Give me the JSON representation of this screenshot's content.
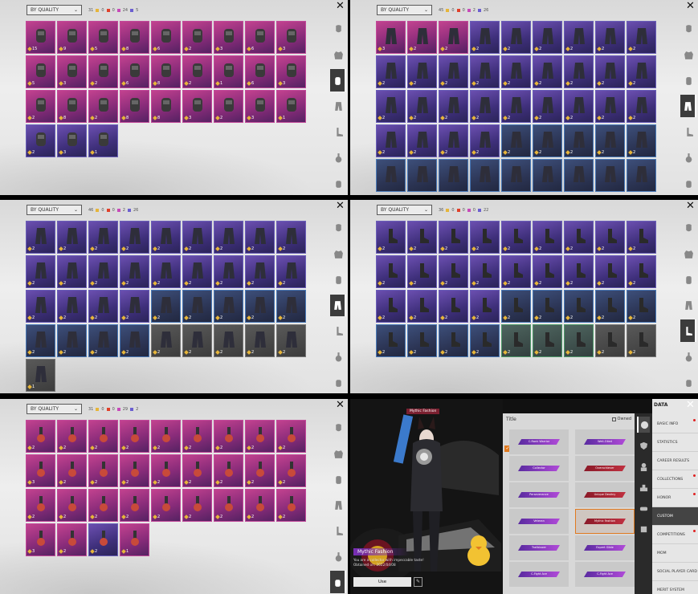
{
  "panels": [
    {
      "sort_label": "BY QUALITY",
      "total": "31",
      "counts": [
        "0",
        "0",
        "24",
        "5"
      ],
      "active_tab": 3,
      "cells": [
        {
          "q": "15",
          "c": "pink"
        },
        {
          "q": "9",
          "c": "pink"
        },
        {
          "q": "5",
          "c": "pink"
        },
        {
          "q": "8",
          "c": "pink"
        },
        {
          "q": "6",
          "c": "pink"
        },
        {
          "q": "2",
          "c": "pink"
        },
        {
          "q": "3",
          "c": "pink"
        },
        {
          "q": "6",
          "c": "pink"
        },
        {
          "q": "3",
          "c": "pink"
        },
        {
          "q": "5",
          "c": "pink"
        },
        {
          "q": "3",
          "c": "pink"
        },
        {
          "q": "2",
          "c": "pink"
        },
        {
          "q": "6",
          "c": "pink"
        },
        {
          "q": "8",
          "c": "pink"
        },
        {
          "q": "2",
          "c": "pink"
        },
        {
          "q": "1",
          "c": "pink"
        },
        {
          "q": "6",
          "c": "pink"
        },
        {
          "q": "3",
          "c": "pink"
        },
        {
          "q": "2",
          "c": "pink"
        },
        {
          "q": "8",
          "c": "pink"
        },
        {
          "q": "2",
          "c": "pink"
        },
        {
          "q": "8",
          "c": "pink"
        },
        {
          "q": "8",
          "c": "pink"
        },
        {
          "q": "3",
          "c": "pink"
        },
        {
          "q": "2",
          "c": "pink"
        },
        {
          "q": "3",
          "c": "pink"
        },
        {
          "q": "1",
          "c": "pink"
        },
        {
          "q": "2",
          "c": ""
        },
        {
          "q": "3",
          "c": ""
        },
        {
          "q": "1",
          "c": ""
        }
      ]
    },
    {
      "sort_label": "BY QUALITY",
      "total": "45",
      "counts": [
        "0",
        "0",
        "2",
        "26"
      ],
      "active_tab": 4,
      "cells": [
        {
          "q": "3",
          "c": "pink"
        },
        {
          "q": "2",
          "c": "pink"
        },
        {
          "q": "2",
          "c": "pink"
        },
        {
          "q": "2",
          "c": ""
        },
        {
          "q": "2",
          "c": ""
        },
        {
          "q": "2",
          "c": ""
        },
        {
          "q": "2",
          "c": ""
        },
        {
          "q": "2",
          "c": ""
        },
        {
          "q": "2",
          "c": ""
        },
        {
          "q": "2",
          "c": ""
        },
        {
          "q": "2",
          "c": ""
        },
        {
          "q": "2",
          "c": ""
        },
        {
          "q": "2",
          "c": ""
        },
        {
          "q": "2",
          "c": ""
        },
        {
          "q": "2",
          "c": ""
        },
        {
          "q": "2",
          "c": ""
        },
        {
          "q": "2",
          "c": ""
        },
        {
          "q": "2",
          "c": ""
        },
        {
          "q": "2",
          "c": ""
        },
        {
          "q": "2",
          "c": ""
        },
        {
          "q": "2",
          "c": ""
        },
        {
          "q": "2",
          "c": ""
        },
        {
          "q": "2",
          "c": ""
        },
        {
          "q": "2",
          "c": ""
        },
        {
          "q": "2",
          "c": ""
        },
        {
          "q": "2",
          "c": ""
        },
        {
          "q": "2",
          "c": ""
        },
        {
          "q": "2",
          "c": ""
        },
        {
          "q": "2",
          "c": ""
        },
        {
          "q": "2",
          "c": ""
        },
        {
          "q": "2",
          "c": ""
        },
        {
          "q": "2",
          "c": "blue"
        },
        {
          "q": "2",
          "c": "blue"
        },
        {
          "q": "2",
          "c": "blue"
        },
        {
          "q": "2",
          "c": "blue"
        },
        {
          "q": "2",
          "c": "blue"
        },
        {
          "q": "",
          "c": "blue"
        },
        {
          "q": "",
          "c": "blue"
        },
        {
          "q": "",
          "c": "blue"
        },
        {
          "q": "",
          "c": "blue"
        },
        {
          "q": "",
          "c": "blue"
        },
        {
          "q": "",
          "c": "blue"
        },
        {
          "q": "",
          "c": "blue"
        },
        {
          "q": "",
          "c": "blue"
        },
        {
          "q": "",
          "c": "blue"
        }
      ]
    },
    {
      "sort_label": "BY QUALITY",
      "total": "46",
      "counts": [
        "0",
        "0",
        "2",
        "26"
      ],
      "active_tab": 4,
      "cells": [
        {
          "q": "2",
          "c": ""
        },
        {
          "q": "2",
          "c": ""
        },
        {
          "q": "2",
          "c": ""
        },
        {
          "q": "2",
          "c": ""
        },
        {
          "q": "2",
          "c": ""
        },
        {
          "q": "2",
          "c": ""
        },
        {
          "q": "2",
          "c": ""
        },
        {
          "q": "2",
          "c": ""
        },
        {
          "q": "2",
          "c": ""
        },
        {
          "q": "2",
          "c": ""
        },
        {
          "q": "2",
          "c": ""
        },
        {
          "q": "2",
          "c": ""
        },
        {
          "q": "2",
          "c": ""
        },
        {
          "q": "2",
          "c": ""
        },
        {
          "q": "2",
          "c": ""
        },
        {
          "q": "2",
          "c": ""
        },
        {
          "q": "2",
          "c": ""
        },
        {
          "q": "2",
          "c": ""
        },
        {
          "q": "2",
          "c": ""
        },
        {
          "q": "2",
          "c": ""
        },
        {
          "q": "2",
          "c": ""
        },
        {
          "q": "2",
          "c": ""
        },
        {
          "q": "2",
          "c": "blue"
        },
        {
          "q": "2",
          "c": "blue"
        },
        {
          "q": "2",
          "c": "blue"
        },
        {
          "q": "2",
          "c": "blue"
        },
        {
          "q": "2",
          "c": "blue"
        },
        {
          "q": "2",
          "c": "blue"
        },
        {
          "q": "2",
          "c": "blue"
        },
        {
          "q": "2",
          "c": "blue"
        },
        {
          "q": "2",
          "c": "blue"
        },
        {
          "q": "2",
          "c": "gray"
        },
        {
          "q": "2",
          "c": "gray"
        },
        {
          "q": "2",
          "c": "gray"
        },
        {
          "q": "2",
          "c": "gray"
        },
        {
          "q": "2",
          "c": "gray"
        },
        {
          "q": "1",
          "c": "gray"
        }
      ]
    },
    {
      "sort_label": "BY QUALITY",
      "total": "36",
      "counts": [
        "0",
        "0",
        "0",
        "22"
      ],
      "active_tab": 5,
      "cells": [
        {
          "q": "2",
          "c": ""
        },
        {
          "q": "2",
          "c": ""
        },
        {
          "q": "2",
          "c": ""
        },
        {
          "q": "2",
          "c": ""
        },
        {
          "q": "2",
          "c": ""
        },
        {
          "q": "2",
          "c": ""
        },
        {
          "q": "2",
          "c": ""
        },
        {
          "q": "2",
          "c": ""
        },
        {
          "q": "2",
          "c": ""
        },
        {
          "q": "2",
          "c": ""
        },
        {
          "q": "2",
          "c": ""
        },
        {
          "q": "2",
          "c": ""
        },
        {
          "q": "2",
          "c": ""
        },
        {
          "q": "2",
          "c": ""
        },
        {
          "q": "2",
          "c": ""
        },
        {
          "q": "2",
          "c": ""
        },
        {
          "q": "2",
          "c": ""
        },
        {
          "q": "2",
          "c": ""
        },
        {
          "q": "2",
          "c": ""
        },
        {
          "q": "2",
          "c": ""
        },
        {
          "q": "2",
          "c": ""
        },
        {
          "q": "2",
          "c": ""
        },
        {
          "q": "2",
          "c": "blue"
        },
        {
          "q": "2",
          "c": "blue"
        },
        {
          "q": "2",
          "c": "blue"
        },
        {
          "q": "2",
          "c": "blue"
        },
        {
          "q": "2",
          "c": "blue"
        },
        {
          "q": "2",
          "c": "blue"
        },
        {
          "q": "2",
          "c": "blue"
        },
        {
          "q": "2",
          "c": "blue"
        },
        {
          "q": "2",
          "c": "blue"
        },
        {
          "q": "2",
          "c": "green"
        },
        {
          "q": "2",
          "c": "green"
        },
        {
          "q": "2",
          "c": "green"
        },
        {
          "q": "2",
          "c": "gray"
        },
        {
          "q": "2",
          "c": "gray"
        }
      ]
    },
    {
      "sort_label": "BY QUALITY",
      "total": "31",
      "counts": [
        "0",
        "0",
        "29",
        "2"
      ],
      "active_tab": 7,
      "cells": [
        {
          "q": "2",
          "c": "pink"
        },
        {
          "q": "2",
          "c": "pink"
        },
        {
          "q": "2",
          "c": "pink"
        },
        {
          "q": "2",
          "c": "pink"
        },
        {
          "q": "2",
          "c": "pink"
        },
        {
          "q": "2",
          "c": "pink"
        },
        {
          "q": "2",
          "c": "pink"
        },
        {
          "q": "2",
          "c": "pink"
        },
        {
          "q": "2",
          "c": "pink"
        },
        {
          "q": "3",
          "c": "pink"
        },
        {
          "q": "2",
          "c": "pink"
        },
        {
          "q": "2",
          "c": "pink"
        },
        {
          "q": "2",
          "c": "pink"
        },
        {
          "q": "2",
          "c": "pink"
        },
        {
          "q": "2",
          "c": "pink"
        },
        {
          "q": "2",
          "c": "pink"
        },
        {
          "q": "2",
          "c": "pink"
        },
        {
          "q": "2",
          "c": "pink"
        },
        {
          "q": "2",
          "c": "pink"
        },
        {
          "q": "2",
          "c": "pink"
        },
        {
          "q": "2",
          "c": "pink"
        },
        {
          "q": "2",
          "c": "pink"
        },
        {
          "q": "2",
          "c": "pink"
        },
        {
          "q": "2",
          "c": "pink"
        },
        {
          "q": "2",
          "c": "pink"
        },
        {
          "q": "2",
          "c": "pink"
        },
        {
          "q": "2",
          "c": "pink"
        },
        {
          "q": "3",
          "c": "pink"
        },
        {
          "q": "2",
          "c": "pink"
        },
        {
          "q": "2",
          "c": ""
        },
        {
          "q": "1",
          "c": "pink"
        }
      ]
    }
  ],
  "count_colors": [
    "#e6b53a",
    "#e0402a",
    "#c74ab8",
    "#6b5fd0"
  ],
  "data_screen": {
    "tag_top": "Mythic Fashion",
    "outfit_name": "Mythic Fashion",
    "outfit_desc": "You are a collector with impeccable taste! Obtained on: 2022/04/08",
    "use_label": "Use",
    "titles_header": "Title",
    "owned_label": "Owned",
    "titles": [
      {
        "label": "C-Rank Warrior",
        "style": ""
      },
      {
        "label": "Well-Oiled",
        "style": ""
      },
      {
        "label": "Collector",
        "style": ""
      },
      {
        "label": "Overachiever",
        "style": "r"
      },
      {
        "label": "Perseverance",
        "style": ""
      },
      {
        "label": "Unique Destiny",
        "style": "r"
      },
      {
        "label": "Veteran",
        "style": ""
      },
      {
        "label": "Mythic Fashion",
        "style": "r"
      },
      {
        "label": "Trailblazer",
        "style": ""
      },
      {
        "label": "Expert Glide",
        "style": ""
      },
      {
        "label": "C-Fight Ace",
        "style": ""
      },
      {
        "label": "C-Fight Ace",
        "style": ""
      }
    ],
    "menu_title": "DATA",
    "menu": [
      {
        "label": "BASIC INFO",
        "dot": true,
        "active": false
      },
      {
        "label": "STATISTICS",
        "dot": false,
        "active": false
      },
      {
        "label": "CAREER RESULTS",
        "dot": false,
        "active": false
      },
      {
        "label": "COLLECTIONS",
        "dot": true,
        "active": false
      },
      {
        "label": "HONOR",
        "dot": true,
        "active": false
      },
      {
        "label": "CUSTOM",
        "dot": false,
        "active": true
      },
      {
        "label": "COMPETITIONS",
        "dot": true,
        "active": false
      },
      {
        "label": "MOM",
        "dot": false,
        "active": false
      },
      {
        "label": "SOCIAL PLAYER CARD",
        "dot": false,
        "active": false
      },
      {
        "label": "MERIT SYSTEM",
        "dot": false,
        "active": false
      }
    ]
  },
  "side_tabs": [
    "mask-icon",
    "jacket-icon",
    "backpack-icon",
    "pants-icon",
    "shoes-icon",
    "potion-icon",
    "hand-icon"
  ]
}
